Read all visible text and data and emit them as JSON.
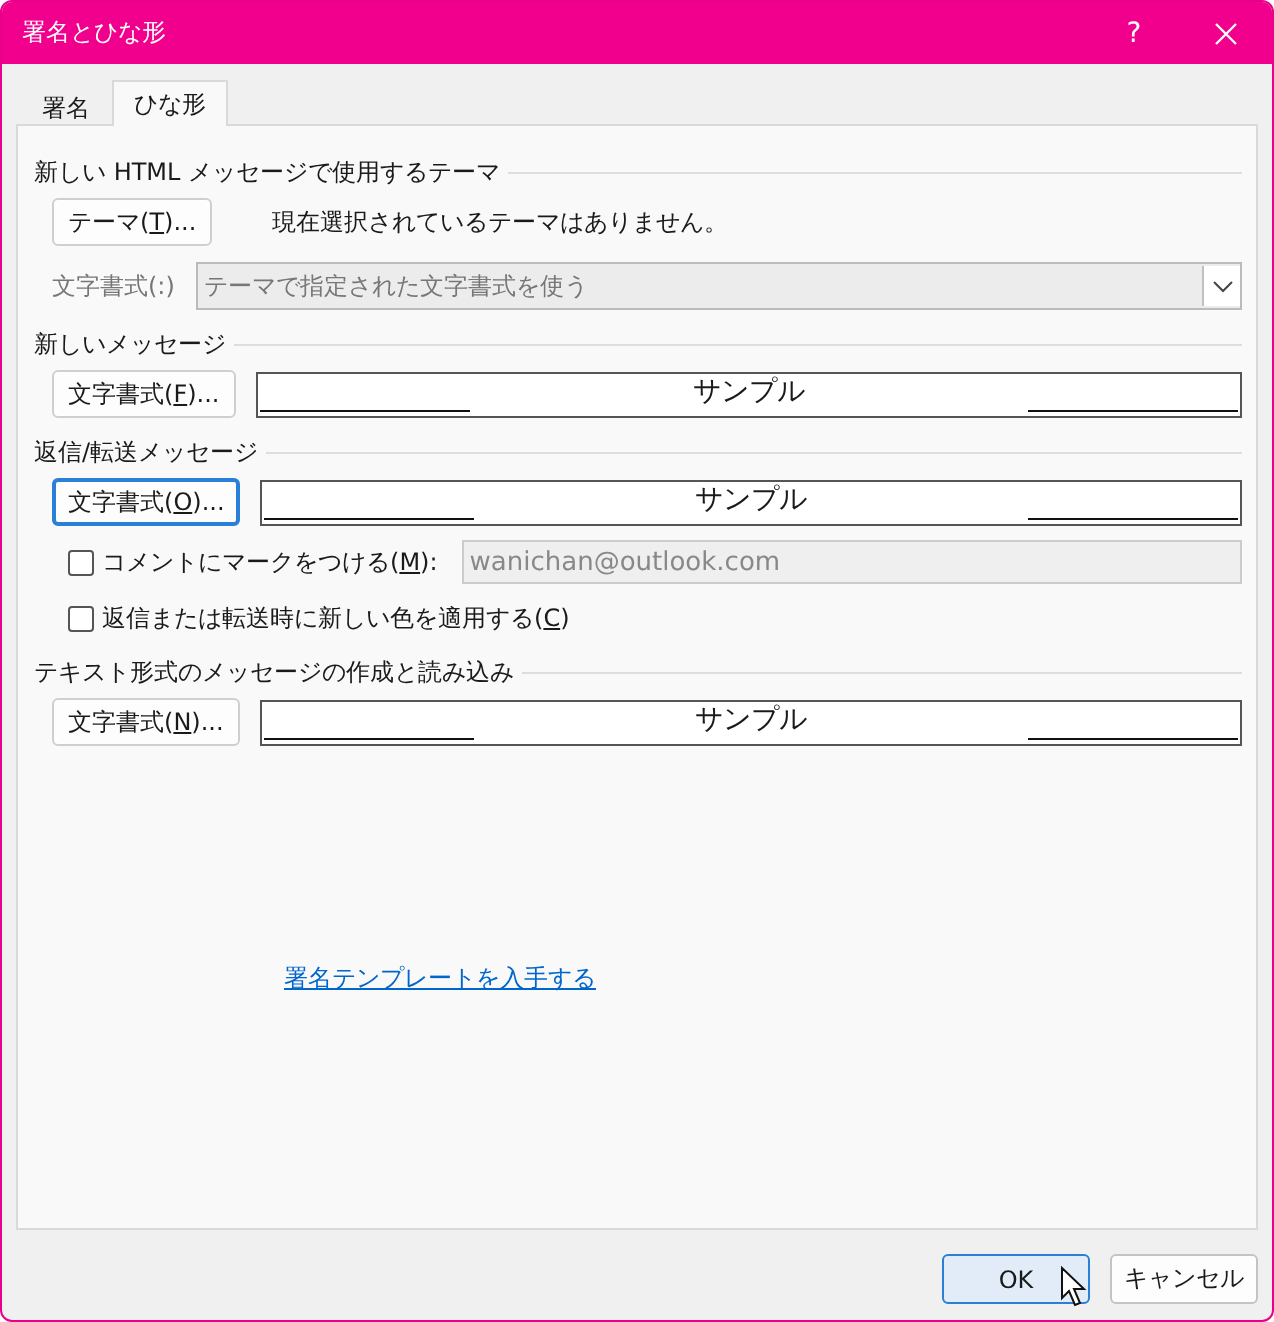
{
  "window": {
    "title": "署名とひな形",
    "help": "?"
  },
  "tabs": [
    {
      "label": "署名",
      "selected": false
    },
    {
      "label": "ひな形",
      "selected": true
    }
  ],
  "sections": [
    {
      "kind": "theme",
      "heading": "新しい HTML メッセージで使用するテーマ",
      "button": {
        "before": "テーマ(",
        "key": "T",
        "after": ")...",
        "focused": false
      },
      "status": "現在選択されているテーマはありません。",
      "font_label": "文字書式(:)",
      "font_select": {
        "value": "テーマで指定された文字書式を使う",
        "disabled": true
      }
    },
    {
      "kind": "font",
      "heading": "新しいメッセージ",
      "button": {
        "before": "文字書式(",
        "key": "F",
        "after": ")...",
        "focused": false
      },
      "sample": "サンプル"
    },
    {
      "kind": "font",
      "heading": "返信/転送メッセージ",
      "button": {
        "before": "文字書式(",
        "key": "O",
        "after": ")...",
        "focused": true
      },
      "sample": "サンプル",
      "options": [
        {
          "label": {
            "before": "コメントにマークをつける(",
            "key": "M",
            "after": "):"
          },
          "checked": false,
          "field": {
            "value": "wanichan@outlook.com",
            "disabled": true
          }
        },
        {
          "label": {
            "before": "返信または転送時に新しい色を適用する(",
            "key": "C",
            "after": ")"
          },
          "checked": false
        }
      ]
    },
    {
      "kind": "font",
      "heading": "テキスト形式のメッセージの作成と読み込み",
      "button": {
        "before": "文字書式(",
        "key": "N",
        "after": ")...",
        "focused": false
      },
      "sample": "サンプル"
    }
  ],
  "link": "署名テンプレートを入手する",
  "buttons": [
    {
      "label": "OK",
      "default": true
    },
    {
      "label": "キャンセル",
      "default": false
    }
  ]
}
